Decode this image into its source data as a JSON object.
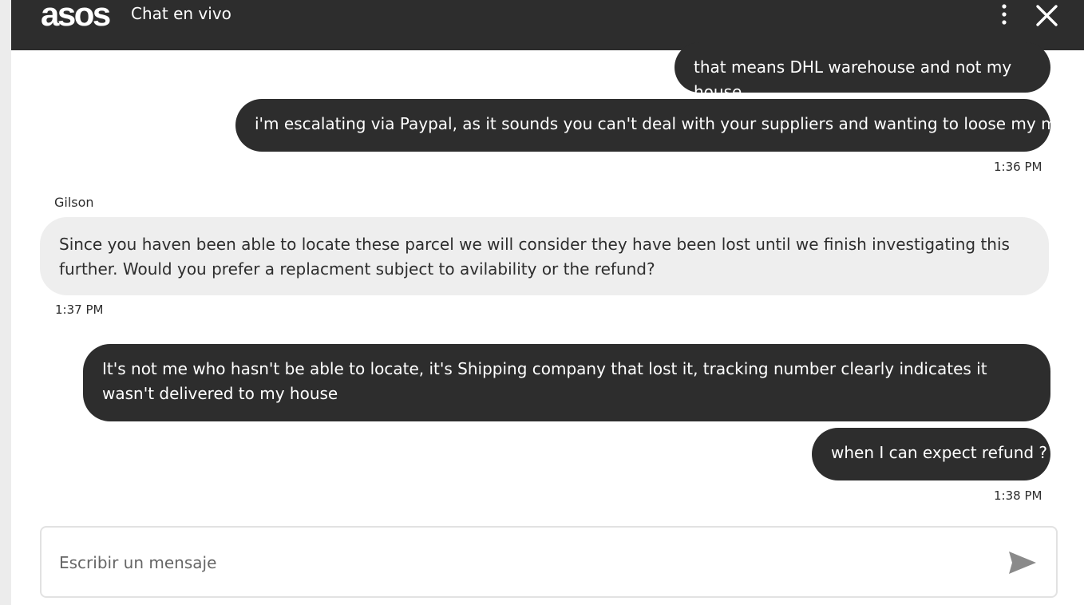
{
  "header": {
    "logo": "asos",
    "title": "Chat en vivo",
    "menu_icon": "more-vertical-icon",
    "close_icon": "close-icon"
  },
  "messages": [
    {
      "direction": "out",
      "text": "that means DHL warehouse and not my house"
    },
    {
      "direction": "out",
      "text": "i'm escalating via Paypal, as it sounds you can't deal with your suppliers and wanting to loose my money!",
      "time": "1:36 PM"
    },
    {
      "direction": "in",
      "sender": "Gilson",
      "text": "Since you haven been able to locate these parcel we will consider they have been lost until we finish investigating this further. Would you prefer a replacment subject to avilability or the refund?",
      "time": "1:37 PM"
    },
    {
      "direction": "out",
      "text": "It's not me who hasn't be able to locate, it's Shipping company that lost it, tracking number clearly indicates it wasn't delivered to my house"
    },
    {
      "direction": "out",
      "text": "when I can expect refund ?",
      "time": "1:38 PM"
    }
  ],
  "composer": {
    "placeholder": "Escribir un mensaje",
    "send_icon": "send-icon"
  },
  "colors": {
    "header_bg": "#2d2d2d",
    "outgoing_bubble": "#2d2d2d",
    "incoming_bubble": "#eeeeee",
    "text_dark": "#2d2d2d"
  }
}
